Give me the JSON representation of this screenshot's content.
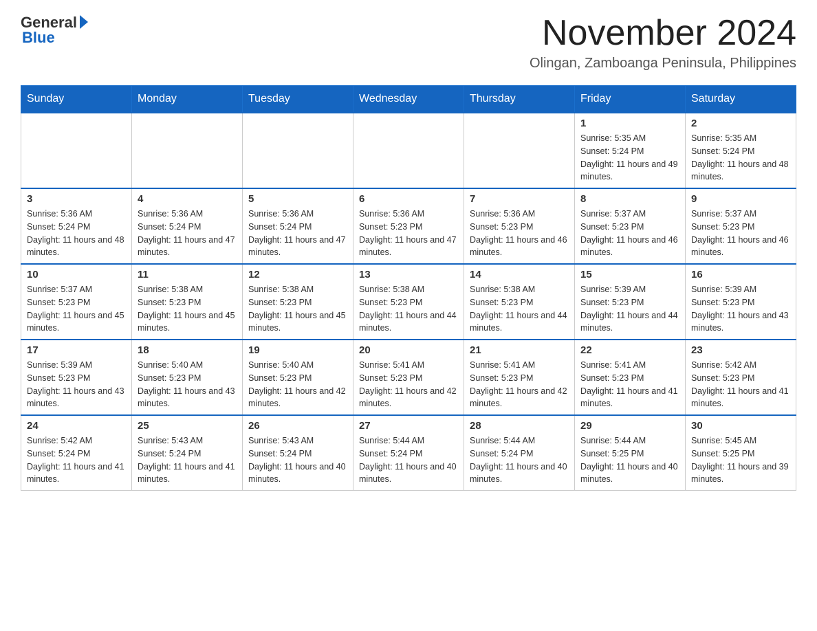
{
  "logo": {
    "general": "General",
    "blue": "Blue"
  },
  "header": {
    "month_year": "November 2024",
    "location": "Olingan, Zamboanga Peninsula, Philippines"
  },
  "weekdays": [
    "Sunday",
    "Monday",
    "Tuesday",
    "Wednesday",
    "Thursday",
    "Friday",
    "Saturday"
  ],
  "weeks": [
    [
      {
        "day": "",
        "info": ""
      },
      {
        "day": "",
        "info": ""
      },
      {
        "day": "",
        "info": ""
      },
      {
        "day": "",
        "info": ""
      },
      {
        "day": "",
        "info": ""
      },
      {
        "day": "1",
        "info": "Sunrise: 5:35 AM\nSunset: 5:24 PM\nDaylight: 11 hours and 49 minutes."
      },
      {
        "day": "2",
        "info": "Sunrise: 5:35 AM\nSunset: 5:24 PM\nDaylight: 11 hours and 48 minutes."
      }
    ],
    [
      {
        "day": "3",
        "info": "Sunrise: 5:36 AM\nSunset: 5:24 PM\nDaylight: 11 hours and 48 minutes."
      },
      {
        "day": "4",
        "info": "Sunrise: 5:36 AM\nSunset: 5:24 PM\nDaylight: 11 hours and 47 minutes."
      },
      {
        "day": "5",
        "info": "Sunrise: 5:36 AM\nSunset: 5:24 PM\nDaylight: 11 hours and 47 minutes."
      },
      {
        "day": "6",
        "info": "Sunrise: 5:36 AM\nSunset: 5:23 PM\nDaylight: 11 hours and 47 minutes."
      },
      {
        "day": "7",
        "info": "Sunrise: 5:36 AM\nSunset: 5:23 PM\nDaylight: 11 hours and 46 minutes."
      },
      {
        "day": "8",
        "info": "Sunrise: 5:37 AM\nSunset: 5:23 PM\nDaylight: 11 hours and 46 minutes."
      },
      {
        "day": "9",
        "info": "Sunrise: 5:37 AM\nSunset: 5:23 PM\nDaylight: 11 hours and 46 minutes."
      }
    ],
    [
      {
        "day": "10",
        "info": "Sunrise: 5:37 AM\nSunset: 5:23 PM\nDaylight: 11 hours and 45 minutes."
      },
      {
        "day": "11",
        "info": "Sunrise: 5:38 AM\nSunset: 5:23 PM\nDaylight: 11 hours and 45 minutes."
      },
      {
        "day": "12",
        "info": "Sunrise: 5:38 AM\nSunset: 5:23 PM\nDaylight: 11 hours and 45 minutes."
      },
      {
        "day": "13",
        "info": "Sunrise: 5:38 AM\nSunset: 5:23 PM\nDaylight: 11 hours and 44 minutes."
      },
      {
        "day": "14",
        "info": "Sunrise: 5:38 AM\nSunset: 5:23 PM\nDaylight: 11 hours and 44 minutes."
      },
      {
        "day": "15",
        "info": "Sunrise: 5:39 AM\nSunset: 5:23 PM\nDaylight: 11 hours and 44 minutes."
      },
      {
        "day": "16",
        "info": "Sunrise: 5:39 AM\nSunset: 5:23 PM\nDaylight: 11 hours and 43 minutes."
      }
    ],
    [
      {
        "day": "17",
        "info": "Sunrise: 5:39 AM\nSunset: 5:23 PM\nDaylight: 11 hours and 43 minutes."
      },
      {
        "day": "18",
        "info": "Sunrise: 5:40 AM\nSunset: 5:23 PM\nDaylight: 11 hours and 43 minutes."
      },
      {
        "day": "19",
        "info": "Sunrise: 5:40 AM\nSunset: 5:23 PM\nDaylight: 11 hours and 42 minutes."
      },
      {
        "day": "20",
        "info": "Sunrise: 5:41 AM\nSunset: 5:23 PM\nDaylight: 11 hours and 42 minutes."
      },
      {
        "day": "21",
        "info": "Sunrise: 5:41 AM\nSunset: 5:23 PM\nDaylight: 11 hours and 42 minutes."
      },
      {
        "day": "22",
        "info": "Sunrise: 5:41 AM\nSunset: 5:23 PM\nDaylight: 11 hours and 41 minutes."
      },
      {
        "day": "23",
        "info": "Sunrise: 5:42 AM\nSunset: 5:23 PM\nDaylight: 11 hours and 41 minutes."
      }
    ],
    [
      {
        "day": "24",
        "info": "Sunrise: 5:42 AM\nSunset: 5:24 PM\nDaylight: 11 hours and 41 minutes."
      },
      {
        "day": "25",
        "info": "Sunrise: 5:43 AM\nSunset: 5:24 PM\nDaylight: 11 hours and 41 minutes."
      },
      {
        "day": "26",
        "info": "Sunrise: 5:43 AM\nSunset: 5:24 PM\nDaylight: 11 hours and 40 minutes."
      },
      {
        "day": "27",
        "info": "Sunrise: 5:44 AM\nSunset: 5:24 PM\nDaylight: 11 hours and 40 minutes."
      },
      {
        "day": "28",
        "info": "Sunrise: 5:44 AM\nSunset: 5:24 PM\nDaylight: 11 hours and 40 minutes."
      },
      {
        "day": "29",
        "info": "Sunrise: 5:44 AM\nSunset: 5:25 PM\nDaylight: 11 hours and 40 minutes."
      },
      {
        "day": "30",
        "info": "Sunrise: 5:45 AM\nSunset: 5:25 PM\nDaylight: 11 hours and 39 minutes."
      }
    ]
  ]
}
